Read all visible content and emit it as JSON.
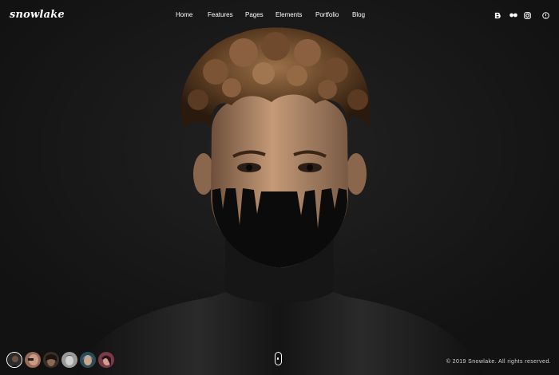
{
  "brand": {
    "logo_text": "snowlake"
  },
  "nav": {
    "items": [
      {
        "label": "Home"
      },
      {
        "label": "Features"
      },
      {
        "label": "Pages"
      },
      {
        "label": "Elements"
      },
      {
        "label": "Portfolio"
      },
      {
        "label": "Blog"
      }
    ]
  },
  "social": {
    "icons": [
      "behance-icon",
      "flickr-icon",
      "instagram-icon",
      "dribbble-icon"
    ]
  },
  "hero": {
    "image_description": "",
    "colors": {
      "background": "#151515",
      "hair": "#6b4a2c",
      "skin": "#b98e6c",
      "paint": "#0c0c0c"
    }
  },
  "slider": {
    "thumbnail_count": 6,
    "active_index": 0
  },
  "footer": {
    "copyright": "© 2019 Snowlake. All rights reserved."
  },
  "colors": {
    "text": "#ffffff",
    "muted_text": "#d6d6d6",
    "accent": "#ffffff"
  }
}
